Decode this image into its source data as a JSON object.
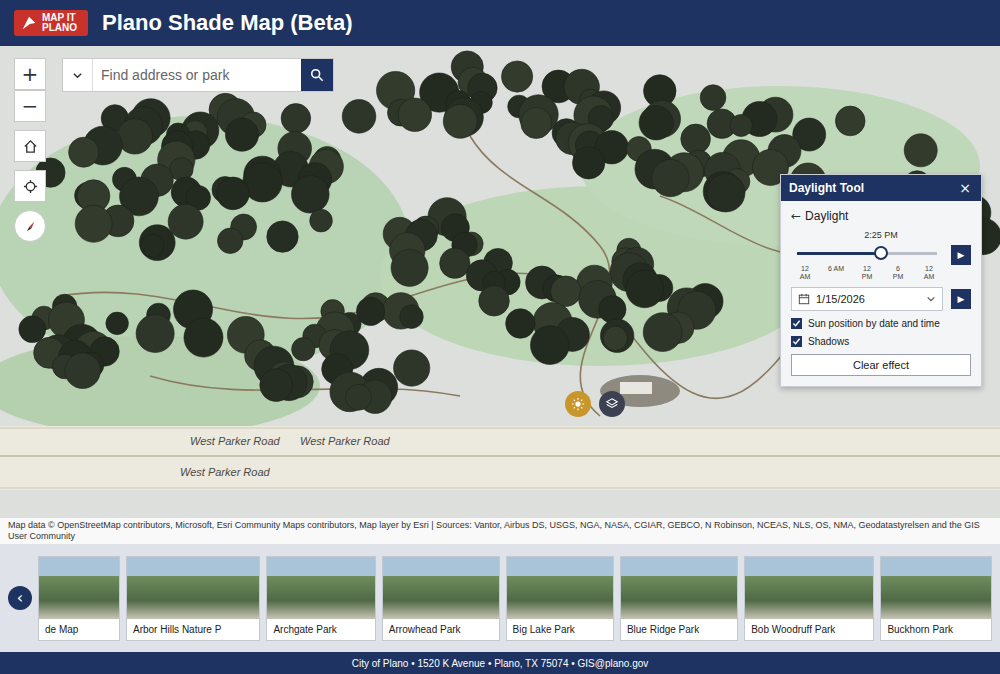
{
  "header": {
    "logo": "MAP IT PLANO",
    "title": "Plano Shade Map (Beta)"
  },
  "search": {
    "placeholder": "Find address or park"
  },
  "map_controls": {
    "zoom_in": "+",
    "zoom_out": "−"
  },
  "roads": [
    "West Parker Road",
    "West Parker Road",
    "West Parker Road"
  ],
  "daylight_tool": {
    "title": "Daylight Tool",
    "close": "×",
    "back": "←",
    "subtitle": "Daylight",
    "time": "2:25 PM",
    "level": 0.6,
    "ticks": [
      "12 AM",
      "6 AM",
      "12 PM",
      "6 PM",
      "12 AM"
    ],
    "play": "▶",
    "date": "1/15/2026",
    "date_play": "▶",
    "options": [
      {
        "label": "Sun position by date and time",
        "checked": true
      },
      {
        "label": "Shadows",
        "checked": true
      }
    ],
    "button": "Clear effect"
  },
  "attribution": "Map data © OpenStreetMap contributors, Microsoft, Esri Community Maps contributors, Map layer by Esri | Sources: Vantor, Airbus DS, USGS, NGA, NASA, CGIAR, GEBCO, N Robinson, NCEAS, NLS, OS, NMA, Geodatastyrelsen and the GIS User Community",
  "gallery": {
    "prev": "‹",
    "items": [
      {
        "label": "de Map"
      },
      {
        "label": "Arbor Hills Nature P"
      },
      {
        "label": "Archgate Park"
      },
      {
        "label": "Arrowhead Park"
      },
      {
        "label": "Big Lake Park"
      },
      {
        "label": "Blue Ridge Park"
      },
      {
        "label": "Bob Woodruff Park"
      },
      {
        "label": "Buckhorn Park"
      }
    ]
  },
  "footer": "City of Plano • 1520 K Avenue • Plano, TX 75074 • GIS@plano.gov"
}
